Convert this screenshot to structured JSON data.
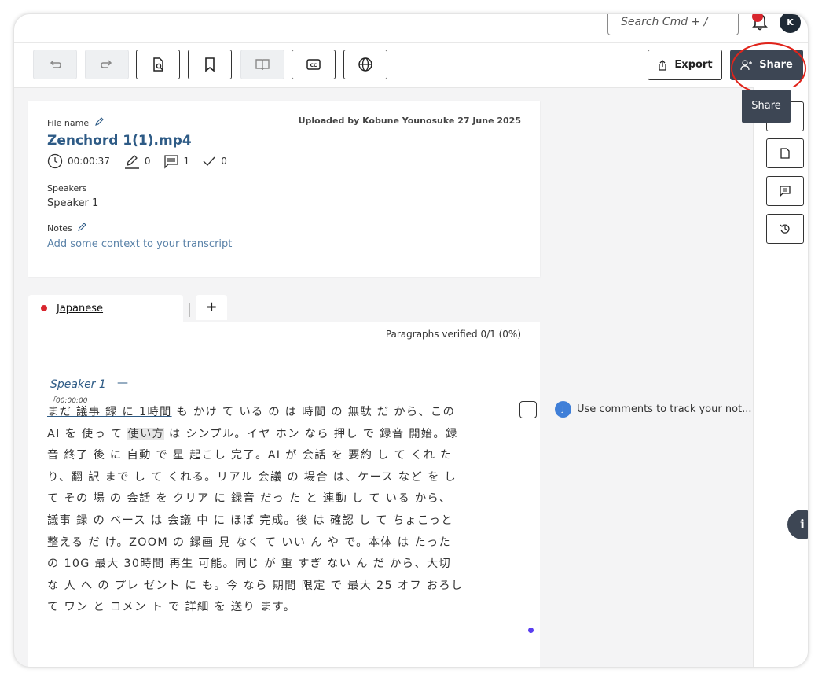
{
  "search": {
    "placeholder": "Search   Cmd + /"
  },
  "user": {
    "initial": "K"
  },
  "toolbar": {
    "export_label": "Export",
    "share_label": "Share",
    "tooltip": "Share"
  },
  "file": {
    "name_label": "File name",
    "name": "Zenchord 1(1).mp4",
    "uploaded": "Uploaded by Kobune Younosuke 27 June 2025",
    "duration": "00:00:37",
    "edits": "0",
    "comments": "1",
    "verified": "0",
    "speakers_label": "Speakers",
    "speakers": "Speaker 1",
    "notes_label": "Notes",
    "notes_placeholder": "Add some context to your transcript"
  },
  "tabs": {
    "language": "Japanese",
    "add": "+"
  },
  "verification": "Paragraphs verified 0/1 (0%)",
  "paragraph": {
    "speaker": "Speaker 1",
    "dash": "—",
    "timestamp": "「00:00:00",
    "seg1": "まだ 議事 録 に 1時間",
    "seg2": " も かけ て いる の は 時間 の 無駄 だ から、この AI を 使っ て ",
    "seg3": "使い方",
    "seg4": " は シンプル。イヤ ホン なら 押し で 録音 開始。録音 終了 後 に 自動 で 星 起こし 完了。AI が 会話 を 要約 し て くれ たり、翻 訳 まで し て くれる。リアル 会議 の 場合 は、ケース など を し て その 場 の 会話 を クリア に 録音 だっ た と 連動 し て いる から、議事 録 の ベース は 会議 中 に ほぼ 完成。後 は 確認 し て ちょこっと 整える だ け。ZOOM の 録画 見 なく て いい ん や で。本体 は たった の 10G 最大 30時間 再生 可能。同じ が 重 すぎ ない ん だ から、大切 な 人 へ の プレ ゼント に も。今 なら 期間 限定 で 最大 25 オフ おろし て ワン と コメン ト で 詳細 を 送り ます。"
  },
  "comment": {
    "avatar": "J",
    "text": "Use comments to track your not..."
  },
  "icons": [
    "undo-icon",
    "redo-icon",
    "search-document-icon",
    "bookmark-icon",
    "book-icon",
    "closed-captions-icon",
    "globe-icon",
    "export-icon",
    "add-user-icon",
    "bell-icon",
    "clock-icon",
    "pencil-icon",
    "comment-icon",
    "check-icon",
    "document-icon",
    "history-icon",
    "info-icon"
  ],
  "colors": {
    "accent": "#2e5b86",
    "share_bg": "#3d4654",
    "highlight_circle": "#e0241b",
    "japanese_dot": "#d8262e"
  }
}
